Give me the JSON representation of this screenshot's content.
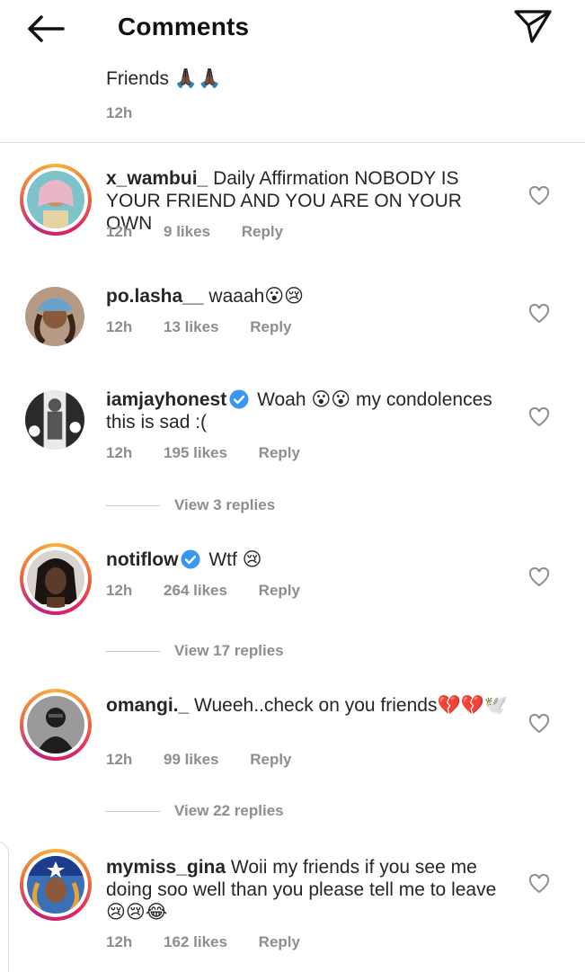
{
  "header": {
    "title": "Comments",
    "back_icon": "arrow-left-icon",
    "send_icon": "paper-plane-icon"
  },
  "caption": {
    "text": "Friends 🙏🏿🙏🏿",
    "time": "12h"
  },
  "colors": {
    "meta_gray": "#8e8e8e",
    "verified_blue": "#3897f0",
    "story_ring": "#e0245e"
  },
  "comments": [
    {
      "username": "x_wambui_",
      "verified": false,
      "text": "Daily Affirmation NOBODY IS YOUR FRIEND AND YOU ARE ON YOUR OWN",
      "time": "12h",
      "likes": "9 likes",
      "reply": "Reply"
    },
    {
      "username": "po.lasha__",
      "verified": false,
      "text": "waaah😮😢",
      "time": "12h",
      "likes": "13 likes",
      "reply": "Reply"
    },
    {
      "username": "iamjayhonest",
      "verified": true,
      "text": "Woah 😮😮 my condolences this is sad :(",
      "time": "12h",
      "likes": "195 likes",
      "reply": "Reply",
      "view_replies": "View 3 replies"
    },
    {
      "username": "notiflow",
      "verified": true,
      "text": "Wtf 😢",
      "time": "12h",
      "likes": "264 likes",
      "reply": "Reply",
      "view_replies": "View 17 replies"
    },
    {
      "username": "omangi._",
      "verified": false,
      "text": "Wueeh..check on you friends💔💔🕊️",
      "time": "12h",
      "likes": "99 likes",
      "reply": "Reply",
      "view_replies": "View 22 replies"
    },
    {
      "username": "mymiss_gina",
      "verified": false,
      "text": "Woii my friends if you see me doing soo well than you please tell me to leave 😢😢😂",
      "time": "12h",
      "likes": "162 likes",
      "reply": "Reply"
    }
  ]
}
